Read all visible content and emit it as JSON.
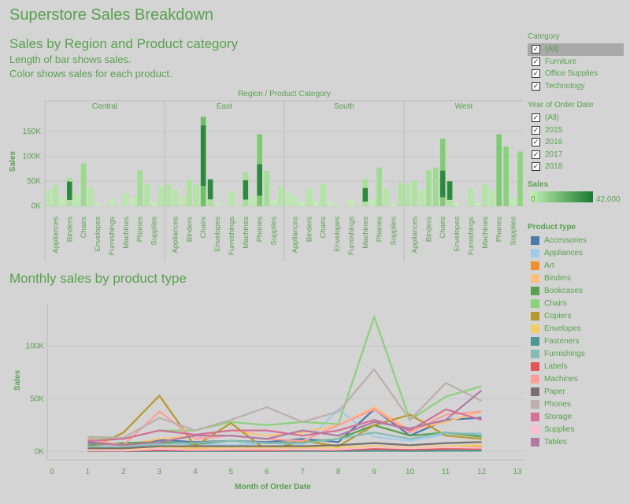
{
  "dashboard": {
    "title": "Superstore Sales Breakdown",
    "bar_title": "Sales by Region and Product category",
    "bar_sub1": "Length of bar shows sales.",
    "bar_sub2": "Color shows sales for each product.",
    "line_title": "Monthly sales by product type"
  },
  "filters": {
    "category": {
      "title": "Category",
      "options": [
        {
          "label": "(All)",
          "checked": true,
          "selected": true
        },
        {
          "label": "Furniture",
          "checked": true
        },
        {
          "label": "Office Supplies",
          "checked": true
        },
        {
          "label": "Technology",
          "checked": true
        }
      ]
    },
    "year": {
      "title": "Year of Order Date",
      "options": [
        {
          "label": "(All)",
          "checked": true
        },
        {
          "label": "2015",
          "checked": true
        },
        {
          "label": "2016",
          "checked": true
        },
        {
          "label": "2017",
          "checked": true
        },
        {
          "label": "2018",
          "checked": true
        }
      ]
    },
    "sales_legend": {
      "title": "Sales",
      "min": "0",
      "max": "42,000",
      "color_low": "#c5f0b6",
      "color_high": "#1a7a2f"
    }
  },
  "product_legend": {
    "title": "Product type",
    "items": [
      {
        "label": "Accessories",
        "color": "#4e79a7"
      },
      {
        "label": "Appliances",
        "color": "#a0cbe8"
      },
      {
        "label": "Art",
        "color": "#f28e2b"
      },
      {
        "label": "Binders",
        "color": "#ffbe7d"
      },
      {
        "label": "Bookcases",
        "color": "#59a14f"
      },
      {
        "label": "Chairs",
        "color": "#8cd17d"
      },
      {
        "label": "Copiers",
        "color": "#b6992d"
      },
      {
        "label": "Envelopes",
        "color": "#f1ce63"
      },
      {
        "label": "Fasteners",
        "color": "#499894"
      },
      {
        "label": "Furnishings",
        "color": "#86bcb6"
      },
      {
        "label": "Labels",
        "color": "#e15759"
      },
      {
        "label": "Machines",
        "color": "#ff9d9a"
      },
      {
        "label": "Paper",
        "color": "#79706e"
      },
      {
        "label": "Phones",
        "color": "#bab0ac"
      },
      {
        "label": "Storage",
        "color": "#d37295"
      },
      {
        "label": "Supplies",
        "color": "#fabfd2"
      },
      {
        "label": "Tables",
        "color": "#b07aa1"
      }
    ]
  },
  "chart_data": [
    {
      "type": "bar",
      "title": "Sales by Region and Product category",
      "header": "Region / Product Category",
      "ylabel": "Sales",
      "ylim": [
        -10000,
        190000
      ],
      "yticks": [
        {
          "v": 0,
          "label": "0K"
        },
        {
          "v": 50000,
          "label": "50K"
        },
        {
          "v": 100000,
          "label": "100K"
        },
        {
          "v": 150000,
          "label": "150K"
        }
      ],
      "grid": true,
      "regions": [
        "Central",
        "East",
        "South",
        "West"
      ],
      "categories": [
        "Accessories",
        "Appliances",
        "Art",
        "Binders",
        "Bookcases",
        "Chairs",
        "Copiers",
        "Envelopes",
        "Fasteners",
        "Furnishings",
        "Labels",
        "Machines",
        "Paper",
        "Phones",
        "Storage",
        "Supplies",
        "Tables"
      ],
      "tick_labels": [
        "Appliances",
        "Binders",
        "Chairs",
        "Envelopes",
        "Furnishings",
        "Machines",
        "Phones",
        "Supplies"
      ],
      "values": {
        "Central": [
          33000,
          42000,
          18000,
          57000,
          24000,
          86000,
          37000,
          4600,
          900,
          15000,
          2500,
          26000,
          17500,
          72000,
          45000,
          8500,
          39000
        ],
        "East": [
          45000,
          34000,
          18000,
          53000,
          44000,
          180000,
          54000,
          4400,
          900,
          30000,
          2500,
          68000,
          21000,
          145000,
          71000,
          13000,
          40000
        ],
        "South": [
          27000,
          20000,
          9000,
          37000,
          10000,
          45000,
          9000,
          3000,
          500,
          13000,
          2000,
          55000,
          14000,
          78000,
          35000,
          4500,
          47000
        ],
        "West": [
          45000,
          51000,
          33000,
          72000,
          78000,
          136000,
          50000,
          6000,
          1000,
          36000,
          5500,
          45000,
          33000,
          145000,
          120000,
          16000,
          110000
        ]
      },
      "dark_segments": [
        {
          "region": "Central",
          "category": "Binders",
          "value": 38000
        },
        {
          "region": "East",
          "category": "Chairs",
          "value": 125000
        },
        {
          "region": "East",
          "category": "Copiers",
          "value": 54000
        },
        {
          "region": "East",
          "category": "Phones",
          "value": 65000
        },
        {
          "region": "East",
          "category": "Machines",
          "value": 40000
        },
        {
          "region": "South",
          "category": "Machines",
          "value": 28000
        },
        {
          "region": "West",
          "category": "Copiers",
          "value": 50000
        },
        {
          "region": "West",
          "category": "Chairs",
          "value": 55000
        }
      ]
    },
    {
      "type": "line",
      "title": "Monthly sales by product type",
      "xlabel": "Month of Order Date",
      "ylabel": "Sales",
      "xlim": [
        0,
        13
      ],
      "ylim": [
        -5000,
        140000
      ],
      "xticks": [
        0,
        1,
        2,
        3,
        4,
        5,
        6,
        7,
        8,
        9,
        10,
        11,
        12,
        13
      ],
      "yticks": [
        {
          "v": 0,
          "label": "0K"
        },
        {
          "v": 50000,
          "label": "50K"
        },
        {
          "v": 100000,
          "label": "100K"
        }
      ],
      "x": [
        1,
        2,
        3,
        4,
        5,
        6,
        7,
        8,
        9,
        10,
        11,
        12
      ],
      "series": [
        {
          "name": "Accessories",
          "values": [
            9000,
            6000,
            11000,
            9000,
            10000,
            9000,
            12000,
            9000,
            40000,
            15000,
            30000,
            32000
          ]
        },
        {
          "name": "Appliances",
          "values": [
            4000,
            3000,
            8000,
            7000,
            6000,
            8000,
            6000,
            40000,
            14000,
            10000,
            16000,
            18000
          ]
        },
        {
          "name": "Art",
          "values": [
            1500,
            1200,
            2500,
            2000,
            2500,
            2000,
            2500,
            2000,
            4000,
            2500,
            5000,
            4500
          ]
        },
        {
          "name": "Binders",
          "values": [
            8000,
            6000,
            12000,
            15000,
            20000,
            15000,
            18000,
            25000,
            42000,
            20000,
            28000,
            38000
          ]
        },
        {
          "name": "Bookcases",
          "values": [
            6000,
            8000,
            9000,
            7000,
            10000,
            8000,
            9000,
            12000,
            25000,
            15000,
            18000,
            14000
          ]
        },
        {
          "name": "Chairs",
          "values": [
            13000,
            12000,
            20000,
            20000,
            28000,
            25000,
            28000,
            26000,
            128000,
            30000,
            52000,
            62000
          ]
        },
        {
          "name": "Copiers",
          "values": [
            2000,
            18000,
            53000,
            5000,
            27000,
            1000,
            10000,
            5000,
            25000,
            35000,
            15000,
            12000
          ]
        },
        {
          "name": "Envelopes",
          "values": [
            2500,
            2000,
            3000,
            3500,
            3000,
            3500,
            3500,
            3500,
            5000,
            3500,
            5000,
            6000
          ]
        },
        {
          "name": "Fasteners",
          "values": [
            300,
            300,
            400,
            400,
            400,
            400,
            500,
            400,
            600,
            500,
            700,
            700
          ]
        },
        {
          "name": "Furnishings",
          "values": [
            5000,
            4000,
            7000,
            8000,
            10000,
            8000,
            8000,
            12000,
            18000,
            12000,
            18000,
            16000
          ]
        },
        {
          "name": "Labels",
          "values": [
            700,
            600,
            1200,
            1000,
            1200,
            900,
            1500,
            1200,
            2500,
            1800,
            2500,
            2500
          ]
        },
        {
          "name": "Machines",
          "values": [
            12000,
            6000,
            38000,
            12000,
            15000,
            12000,
            10000,
            25000,
            40000,
            18000,
            35000,
            38000
          ]
        },
        {
          "name": "Paper",
          "values": [
            3000,
            3000,
            5000,
            5000,
            5000,
            5000,
            5000,
            6000,
            8000,
            6000,
            8000,
            9000
          ]
        },
        {
          "name": "Phones",
          "values": [
            14000,
            13000,
            32000,
            20000,
            30000,
            42000,
            28000,
            38000,
            78000,
            30000,
            65000,
            48000
          ]
        },
        {
          "name": "Storage",
          "values": [
            10000,
            12000,
            20000,
            16000,
            20000,
            20000,
            15000,
            20000,
            30000,
            20000,
            40000,
            30000
          ]
        },
        {
          "name": "Supplies",
          "values": [
            1000,
            800,
            2500,
            1500,
            2000,
            2000,
            2000,
            2000,
            4000,
            3000,
            4000,
            3500
          ]
        },
        {
          "name": "Tables",
          "values": [
            8000,
            6000,
            9000,
            15000,
            15000,
            12000,
            20000,
            15000,
            28000,
            22000,
            30000,
            58000
          ]
        }
      ]
    }
  ]
}
